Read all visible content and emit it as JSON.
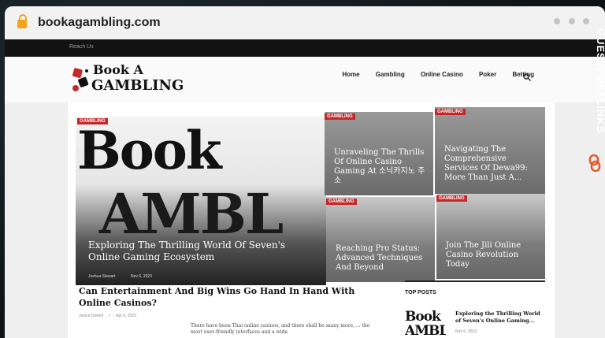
{
  "browser": {
    "url": "bookagambling.com"
  },
  "site": {
    "topbar_link": "Reach Us",
    "logo": {
      "line1": "Book A",
      "line2": "GAMBLING"
    },
    "nav": [
      "Home",
      "Gambling",
      "Online Casino",
      "Poker",
      "Betting"
    ]
  },
  "hero": {
    "main": {
      "badge": "GAMBLING",
      "bg_words": [
        "Book",
        "AMBL"
      ],
      "title": "Exploring The Thrilling World Of Seven's Online Gaming Ecosystem",
      "author": "Joshua Stewart",
      "date": "Nov 6, 2023"
    },
    "tiles": [
      {
        "badge": "GAMBLING",
        "title": "Unraveling The Thrills Of Online Casino Gaming At 소닉카지노 주소"
      },
      {
        "badge": "GAMBLING",
        "title": "Navigating The Comprehensive Services Of Dewa99: More Than Just A..."
      },
      {
        "badge": "GAMBLING",
        "title": "Reaching Pro Status: Advanced Techniques And Beyond"
      },
      {
        "badge": "GAMBLING",
        "title": "Join The Jili Online Casino Revolution Today"
      }
    ]
  },
  "article": {
    "title": "Can Entertainment And Big Wins Go Hand In Hand With Online Casinos?",
    "author": "Janice Dowell",
    "date": "Apr 6, 2023",
    "excerpt": "There have been Thai online casinos, and there shall be many more, ... the most user-friendly interfaces and a wide"
  },
  "sidebar": {
    "heading": "TOP POSTS",
    "post_title": "Exploring the Thrilling World of Seven's Online Gaming...",
    "post_date": "Nov 6, 2023",
    "thumb_words": [
      "Book",
      "AMBL"
    ]
  },
  "watermark": "GUESTPOSTLINKS",
  "colors": {
    "badge": "#c3282b",
    "brand": "#e05a2b"
  }
}
